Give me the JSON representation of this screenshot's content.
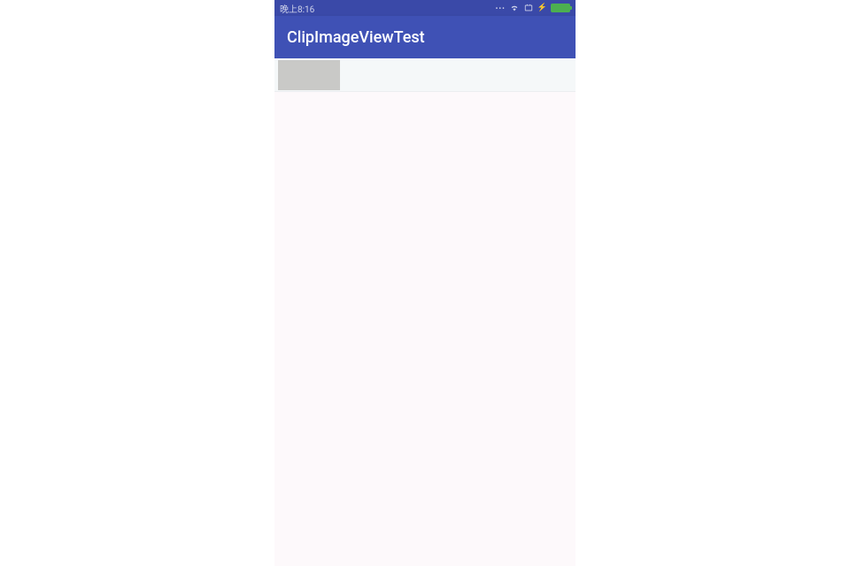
{
  "status_bar": {
    "time": "晚上8:16",
    "icons": {
      "dots": "•••",
      "wifi": "wifi",
      "screenshot": "screenshot",
      "charging": "⚡",
      "battery": "battery-full"
    }
  },
  "app_bar": {
    "title": "ClipImageViewTest"
  }
}
